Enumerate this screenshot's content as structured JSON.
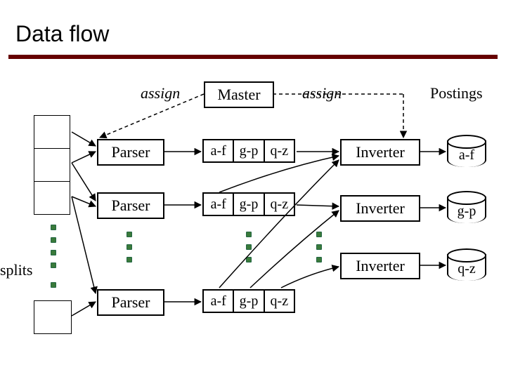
{
  "title": "Data flow",
  "labels": {
    "assign_left": "assign",
    "assign_right": "assign",
    "splits": "splits",
    "postings": "Postings"
  },
  "nodes": {
    "master": "Master",
    "parser": "Parser",
    "inverter": "Inverter"
  },
  "partitions": {
    "a": "a-f",
    "b": "g-p",
    "c": "q-z"
  }
}
